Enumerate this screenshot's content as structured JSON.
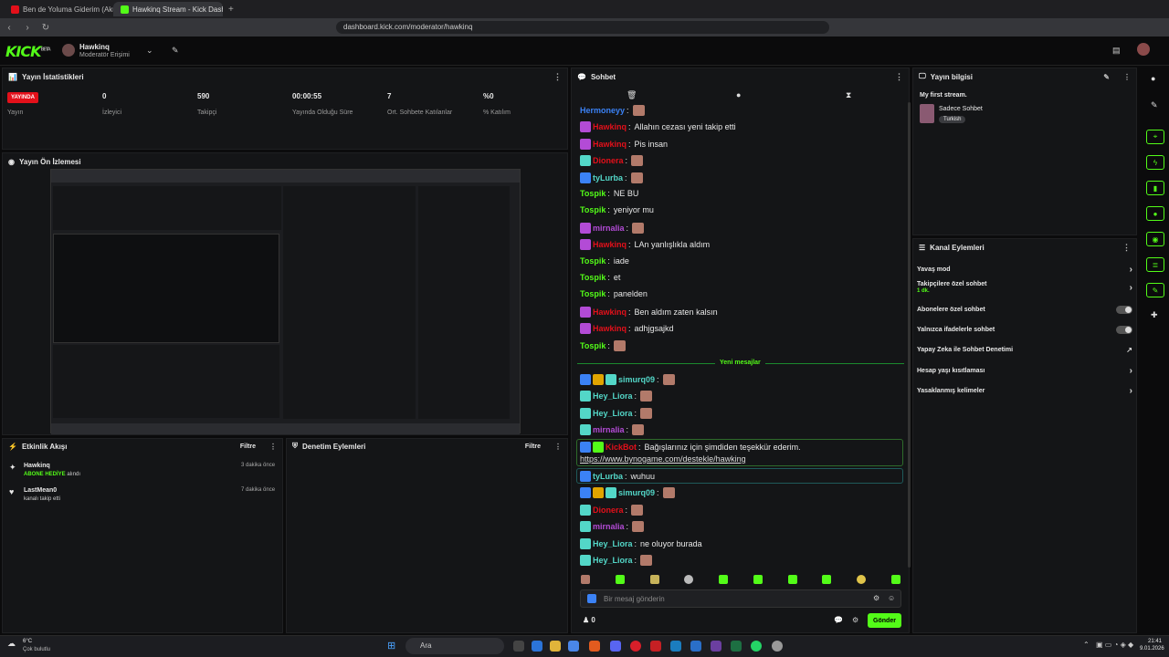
{
  "browser": {
    "tabs": [
      {
        "title": "Ben de Yoluma Giderim (Akustik)"
      },
      {
        "title": "Hawkinq Stream - Kick Dashb"
      }
    ],
    "url": "dashboard.kick.com/moderator/hawkinq"
  },
  "header": {
    "logo": "KICK",
    "beta": "BETA",
    "channel": "Hawkinq",
    "role": "Moderatör Erişimi"
  },
  "stats": {
    "title": "Yayın İstatistikleri",
    "live": "YAYINDA",
    "live_label": "Yayın",
    "items": [
      {
        "value": "0",
        "label": "İzleyici"
      },
      {
        "value": "590",
        "label": "Takipçi"
      },
      {
        "value": "00:00:55",
        "label": "Yayında Olduğu Süre"
      },
      {
        "value": "7",
        "label": "Ort. Sohbete Katılanlar"
      },
      {
        "value": "%0",
        "label": "% Katılım"
      }
    ]
  },
  "preview": {
    "title": "Yayın Ön İzlemesi"
  },
  "activity": {
    "title": "Etkinlik Akışı",
    "filter": "Filtre",
    "items": [
      {
        "user": "Hawkinq",
        "action": "ABONE HEDİYE",
        "suffix": " alındı",
        "time": "3 dakika önce"
      },
      {
        "user": "LastMean0",
        "action": "",
        "suffix": "kanalı takip etti",
        "time": "7 dakika önce"
      }
    ]
  },
  "moderation": {
    "title": "Denetim Eylemleri",
    "filter": "Filtre"
  },
  "chat": {
    "title": "Sohbet",
    "divider": "Yeni mesajlar",
    "input_placeholder": "Bir mesaj gönderin",
    "send": "Gönder",
    "viewers": "0",
    "messages": [
      {
        "user": "Hermoneyy",
        "text": "",
        "color": "#3b82f6",
        "emote": true,
        "icons": []
      },
      {
        "user": "Hawkinq",
        "text": "Allahın cezası yeni takip etti",
        "color": "#e3101a",
        "icons": [
          "#b34bd6"
        ]
      },
      {
        "user": "Hawkinq",
        "text": "Pis insan",
        "color": "#e3101a",
        "icons": [
          "#b34bd6"
        ]
      },
      {
        "user": "Dionera",
        "text": "",
        "color": "#e3101a",
        "emote": true,
        "icons": [
          "#53d7c8"
        ]
      },
      {
        "user": "tyLurba",
        "text": "",
        "color": "#53d7c8",
        "emote": true,
        "icons": [
          "#3b82f6"
        ]
      },
      {
        "user": "Tospik",
        "text": "NE BU",
        "color": "#53fc18",
        "icons": []
      },
      {
        "user": "Tospik",
        "text": "yeniyor mu",
        "color": "#53fc18",
        "icons": []
      },
      {
        "user": "mirnalia",
        "text": "",
        "color": "#b34bd6",
        "emote": true,
        "icons": [
          "#b34bd6"
        ]
      },
      {
        "user": "Hawkinq",
        "text": "LAn yanlışlıkla aldım",
        "color": "#e3101a",
        "icons": [
          "#b34bd6"
        ]
      },
      {
        "user": "Tospik",
        "text": "iade",
        "color": "#53fc18",
        "icons": []
      },
      {
        "user": "Tospik",
        "text": "et",
        "color": "#53fc18",
        "icons": []
      },
      {
        "user": "Tospik",
        "text": "panelden",
        "color": "#53fc18",
        "icons": []
      },
      {
        "user": "Hawkinq",
        "text": "Ben aldım zaten kalsın",
        "color": "#e3101a",
        "icons": [
          "#b34bd6"
        ]
      },
      {
        "user": "Hawkinq",
        "text": "adhjgsajkd",
        "color": "#e3101a",
        "icons": [
          "#b34bd6"
        ]
      },
      {
        "user": "Tospik",
        "text": "",
        "color": "#53fc18",
        "emote": true,
        "icons": []
      }
    ],
    "new_messages": [
      {
        "user": "simurq09",
        "text": "",
        "color": "#53d7c8",
        "emote": true,
        "icons": [
          "#3b82f6",
          "#e0a400",
          "#53d7c8"
        ]
      },
      {
        "user": "Hey_Liora",
        "text": "",
        "color": "#53d7c8",
        "emote": true,
        "icons": [
          "#53d7c8"
        ]
      },
      {
        "user": "Hey_Liora",
        "text": "",
        "color": "#53d7c8",
        "emote": true,
        "icons": [
          "#53d7c8"
        ]
      },
      {
        "user": "mirnalia",
        "text": "",
        "color": "#b34bd6",
        "emote": true,
        "icons": [
          "#53d7c8"
        ]
      },
      {
        "user": "KickBot",
        "text": "Bağışlarınız için şimdiden teşekkür ederim.",
        "link": "https://www.bynogame.com/destekle/hawking",
        "color": "#e3101a",
        "icons": [
          "#3b82f6",
          "#53fc18"
        ]
      },
      {
        "user": "tyLurba",
        "text": "wuhuu",
        "color": "#53d7c8",
        "icons": [
          "#3b82f6"
        ]
      },
      {
        "user": "simurq09",
        "text": "",
        "color": "#53d7c8",
        "emote": true,
        "icons": [
          "#3b82f6",
          "#e0a400",
          "#53d7c8"
        ]
      },
      {
        "user": "Dionera",
        "text": "",
        "color": "#e3101a",
        "emote": true,
        "icons": [
          "#53d7c8"
        ]
      },
      {
        "user": "mirnalia",
        "text": "",
        "color": "#b34bd6",
        "emote": true,
        "icons": [
          "#53d7c8"
        ]
      },
      {
        "user": "Hey_Liora",
        "text": "ne oluyor burada",
        "color": "#53d7c8",
        "icons": [
          "#53d7c8"
        ]
      },
      {
        "user": "Hey_Liora",
        "text": "",
        "color": "#53d7c8",
        "emote": true,
        "icons": [
          "#53d7c8"
        ]
      }
    ]
  },
  "stream_info": {
    "title": "Yayın bilgisi",
    "stream_title": "My first stream.",
    "category": "Sadece Sohbet",
    "tag": "Turkish"
  },
  "channel_actions": {
    "title": "Kanal Eylemleri",
    "items": [
      {
        "label": "Yavaş mod",
        "type": "chevron"
      },
      {
        "label": "Takipçilere özel sohbet",
        "sub": "1 dk.",
        "type": "chevron"
      },
      {
        "label": "Abonelere özel sohbet",
        "type": "toggle"
      },
      {
        "label": "Yalnızca ifadelerle sohbet",
        "type": "toggle"
      },
      {
        "label": "Yapay Zeka ile Sohbet Denetimi",
        "type": "external"
      },
      {
        "label": "Hesap yaşı kısıtlaması",
        "type": "chevron"
      },
      {
        "label": "Yasaklanmış kelimeler",
        "type": "chevron"
      }
    ]
  },
  "taskbar": {
    "weather_temp": "6°C",
    "weather_desc": "Çok bulutlu",
    "search": "Ara",
    "time": "21:41",
    "date": "9.01.2026"
  }
}
